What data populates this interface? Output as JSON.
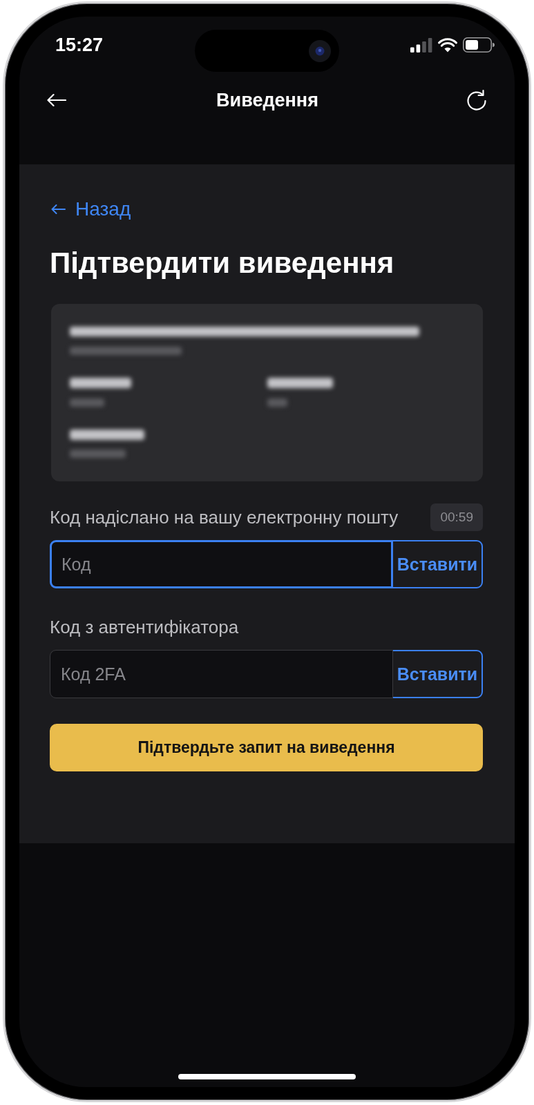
{
  "status_bar": {
    "time": "15:27"
  },
  "nav_bar": {
    "title": "Виведення"
  },
  "back_link": {
    "label": "Назад"
  },
  "page_title": "Підтвердити виведення",
  "code_fields": [
    {
      "label": "Код надіслано на вашу електронну пошту",
      "timer": "00:59",
      "placeholder": "Код",
      "focused": true,
      "paste_label": "Вставити"
    },
    {
      "label": "Код з автентифікатора",
      "placeholder": "Код 2FA",
      "focused": false,
      "paste_label": "Вставити"
    }
  ],
  "submit_button": {
    "label": "Підтвердьте запит на виведення"
  }
}
